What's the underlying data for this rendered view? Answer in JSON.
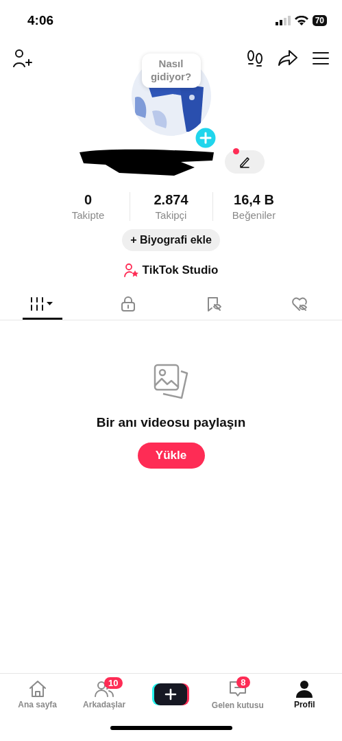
{
  "status_bar": {
    "time": "4:06",
    "battery": "70"
  },
  "profile": {
    "bubble": "Nasıl gidiyor?",
    "live_dot": true
  },
  "stats": [
    {
      "value": "0",
      "label": "Takipte"
    },
    {
      "value": "2.874",
      "label": "Takipçi"
    },
    {
      "value": "16,4 B",
      "label": "Beğeniler"
    }
  ],
  "bio_button": {
    "icon": "+",
    "label": "Biyografi ekle"
  },
  "studio_link": "TikTok Studio",
  "tabs": [
    {
      "kind": "grid",
      "selected": true
    },
    {
      "kind": "lock",
      "selected": false
    },
    {
      "kind": "saved",
      "selected": false
    },
    {
      "kind": "liked",
      "selected": false
    }
  ],
  "empty_state": {
    "message": "Bir anı videosu paylaşın",
    "button": "Yükle"
  },
  "nav": [
    {
      "kind": "home",
      "label": "Ana sayfa",
      "selected": false
    },
    {
      "kind": "friends",
      "label": "Arkadaşlar",
      "selected": false,
      "badge": "10"
    },
    {
      "kind": "create",
      "selected": false
    },
    {
      "kind": "inbox",
      "label": "Gelen kutusu",
      "selected": false,
      "badge": "8"
    },
    {
      "kind": "profile",
      "label": "Profil",
      "selected": true
    }
  ]
}
